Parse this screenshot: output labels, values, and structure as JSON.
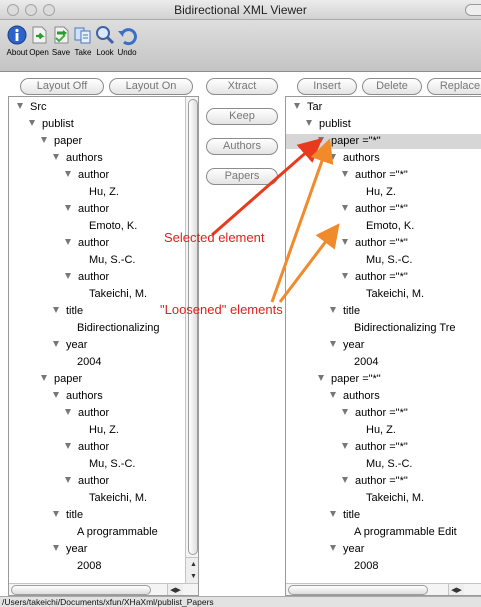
{
  "window": {
    "title": "Bidirectional XML Viewer"
  },
  "toolbar": {
    "items": [
      {
        "label": "About",
        "icon": "info-icon"
      },
      {
        "label": "Open",
        "icon": "open-icon"
      },
      {
        "label": "Save",
        "icon": "save-icon"
      },
      {
        "label": "Take",
        "icon": "take-icon"
      },
      {
        "label": "Look",
        "icon": "magnifier-icon"
      },
      {
        "label": "Undo",
        "icon": "undo-icon"
      }
    ]
  },
  "left_buttons": {
    "layout_off": "Layout Off",
    "layout_on": "Layout On"
  },
  "middle_buttons": {
    "xtract": "Xtract",
    "keep": "Keep",
    "authors": "Authors",
    "papers": "Papers"
  },
  "right_buttons": {
    "insert": "Insert",
    "delete": "Delete",
    "replace": "Replace"
  },
  "left_tree": [
    {
      "t": "Src",
      "d": 0,
      "e": 1
    },
    {
      "t": "publist",
      "d": 1,
      "e": 1
    },
    {
      "t": "paper",
      "d": 2,
      "e": 1
    },
    {
      "t": "authors",
      "d": 3,
      "e": 1
    },
    {
      "t": "author",
      "d": 4,
      "e": 1
    },
    {
      "t": "Hu, Z.",
      "d": 6,
      "e": 0
    },
    {
      "t": "author",
      "d": 4,
      "e": 1
    },
    {
      "t": "Emoto, K.",
      "d": 6,
      "e": 0
    },
    {
      "t": "author",
      "d": 4,
      "e": 1
    },
    {
      "t": "Mu, S.-C.",
      "d": 6,
      "e": 0
    },
    {
      "t": "author",
      "d": 4,
      "e": 1
    },
    {
      "t": "Takeichi, M.",
      "d": 6,
      "e": 0
    },
    {
      "t": "title",
      "d": 3,
      "e": 1
    },
    {
      "t": "Bidirectionalizing",
      "d": 5,
      "e": 0
    },
    {
      "t": "year",
      "d": 3,
      "e": 1
    },
    {
      "t": "2004",
      "d": 5,
      "e": 0
    },
    {
      "t": "paper",
      "d": 2,
      "e": 1
    },
    {
      "t": "authors",
      "d": 3,
      "e": 1
    },
    {
      "t": "author",
      "d": 4,
      "e": 1
    },
    {
      "t": "Hu, Z.",
      "d": 6,
      "e": 0
    },
    {
      "t": "author",
      "d": 4,
      "e": 1
    },
    {
      "t": "Mu, S.-C.",
      "d": 6,
      "e": 0
    },
    {
      "t": "author",
      "d": 4,
      "e": 1
    },
    {
      "t": "Takeichi, M.",
      "d": 6,
      "e": 0
    },
    {
      "t": "title",
      "d": 3,
      "e": 1
    },
    {
      "t": "A programmable",
      "d": 5,
      "e": 0
    },
    {
      "t": "year",
      "d": 3,
      "e": 1
    },
    {
      "t": "2008",
      "d": 5,
      "e": 0
    }
  ],
  "right_tree": [
    {
      "t": "Tar",
      "d": 0,
      "e": 1
    },
    {
      "t": "publist",
      "d": 1,
      "e": 1
    },
    {
      "t": "paper =\"*\"",
      "d": 2,
      "e": 1,
      "s": 1
    },
    {
      "t": "authors",
      "d": 3,
      "e": 1
    },
    {
      "t": "author =\"*\"",
      "d": 4,
      "e": 1
    },
    {
      "t": "Hu, Z.",
      "d": 6,
      "e": 0
    },
    {
      "t": "author =\"*\"",
      "d": 4,
      "e": 1
    },
    {
      "t": "Emoto, K.",
      "d": 6,
      "e": 0
    },
    {
      "t": "author =\"*\"",
      "d": 4,
      "e": 1
    },
    {
      "t": "Mu, S.-C.",
      "d": 6,
      "e": 0
    },
    {
      "t": "author =\"*\"",
      "d": 4,
      "e": 1
    },
    {
      "t": "Takeichi, M.",
      "d": 6,
      "e": 0
    },
    {
      "t": "title",
      "d": 3,
      "e": 1
    },
    {
      "t": "Bidirectionalizing Tre",
      "d": 5,
      "e": 0
    },
    {
      "t": "year",
      "d": 3,
      "e": 1
    },
    {
      "t": "2004",
      "d": 5,
      "e": 0
    },
    {
      "t": "paper =\"*\"",
      "d": 2,
      "e": 1
    },
    {
      "t": "authors",
      "d": 3,
      "e": 1
    },
    {
      "t": "author =\"*\"",
      "d": 4,
      "e": 1
    },
    {
      "t": "Hu, Z.",
      "d": 6,
      "e": 0
    },
    {
      "t": "author =\"*\"",
      "d": 4,
      "e": 1
    },
    {
      "t": "Mu, S.-C.",
      "d": 6,
      "e": 0
    },
    {
      "t": "author =\"*\"",
      "d": 4,
      "e": 1
    },
    {
      "t": "Takeichi, M.",
      "d": 6,
      "e": 0
    },
    {
      "t": "title",
      "d": 3,
      "e": 1
    },
    {
      "t": "A programmable Edit",
      "d": 5,
      "e": 0
    },
    {
      "t": "year",
      "d": 3,
      "e": 1
    },
    {
      "t": "2008",
      "d": 5,
      "e": 0
    }
  ],
  "annotations": {
    "selected": "Selected element",
    "loosened": "\"Loosened\" elements"
  },
  "status": {
    "path": "/Users/takeichi/Documents/xfun/XHaXml/publist_Papers"
  },
  "colors": {
    "arrow": "#e83a1c",
    "arrow_orange": "#f08a2a",
    "selection": "#d6d6d6"
  }
}
